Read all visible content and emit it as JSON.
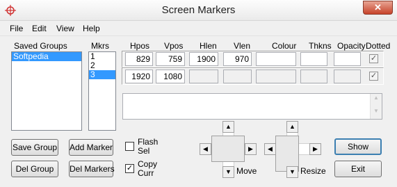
{
  "window": {
    "title": "Screen Markers",
    "close_glyph": "✕"
  },
  "menu": [
    "File",
    "Edit",
    "View",
    "Help"
  ],
  "saved_groups": {
    "label": "Saved Groups",
    "items": [
      "Softpedia"
    ],
    "selected": 0
  },
  "markers": {
    "label": "Mkrs",
    "items": [
      "1",
      "2",
      "3"
    ],
    "selected": 2
  },
  "columns": {
    "hpos": "Hpos",
    "vpos": "Vpos",
    "hlen": "Hlen",
    "vlen": "Vlen",
    "colour": "Colour",
    "thkns": "Thkns",
    "opacity": "Opacity",
    "dotted": "Dotted"
  },
  "rows": [
    {
      "hpos": "829",
      "vpos": "759",
      "hlen": "1900",
      "vlen": "970",
      "colour": "",
      "thkns": "",
      "opacity": "",
      "dotted": true
    },
    {
      "hpos": "1920",
      "vpos": "1080",
      "hlen": "",
      "vlen": "",
      "colour": "",
      "thkns": "",
      "opacity": "",
      "dotted": true
    }
  ],
  "notes": "",
  "buttons": {
    "save_group": "Save Group",
    "add_marker": "Add Marker",
    "del_group": "Del Group",
    "del_markers": "Del Markers",
    "show": "Show",
    "exit": "Exit"
  },
  "options": {
    "flash_sel": {
      "label1": "Flash",
      "label2": "Sel",
      "checked": false
    },
    "copy_curr": {
      "label1": "Copy",
      "label2": "Curr",
      "checked": true
    }
  },
  "controls": {
    "move": "Move",
    "resize": "Resize"
  },
  "icons": {
    "app": "crosshair-icon"
  }
}
